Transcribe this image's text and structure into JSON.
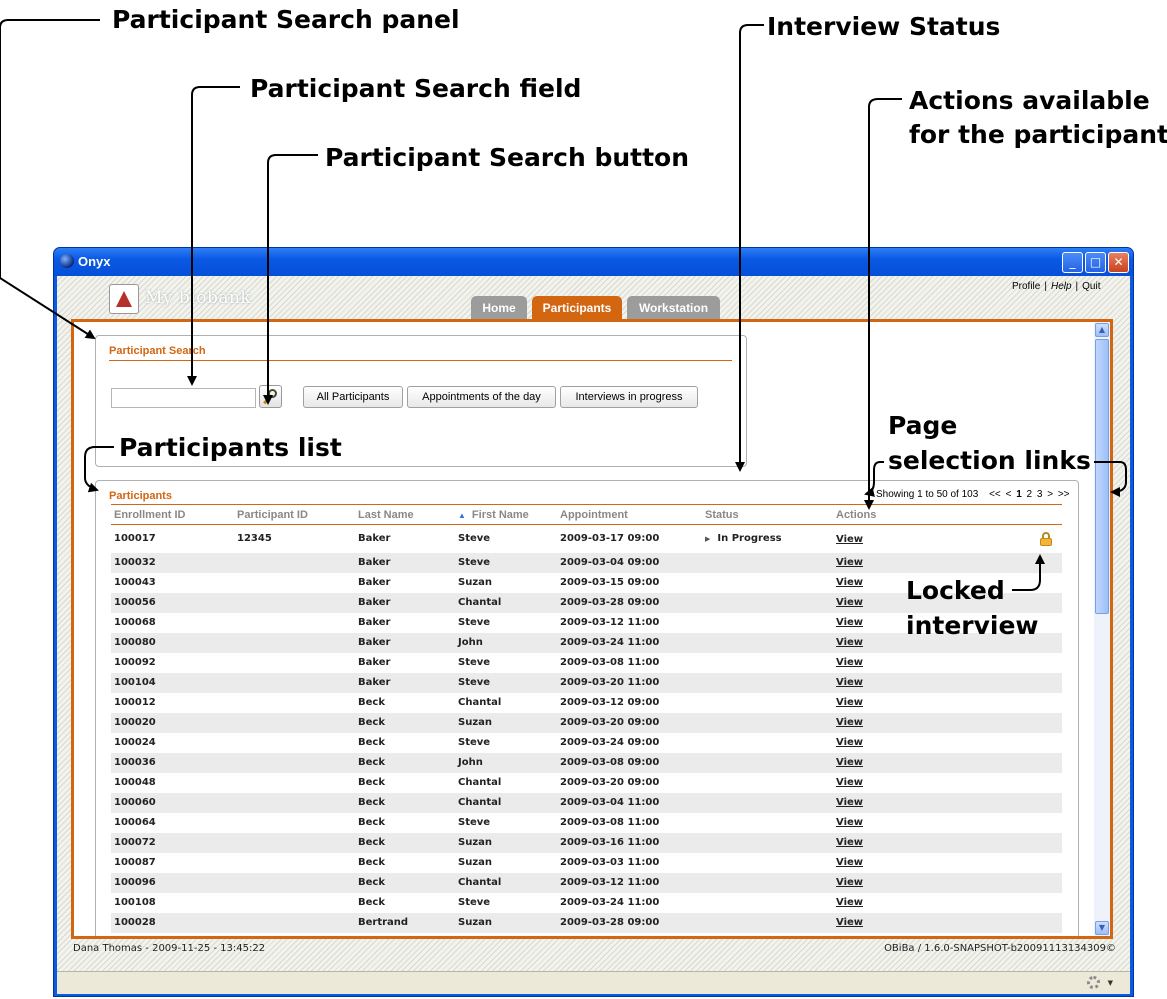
{
  "annotations": {
    "search_panel": "Participant Search panel",
    "search_field": "Participant Search field",
    "search_button": "Participant Search button",
    "interview_status": "Interview Status",
    "actions_line1": "Actions available",
    "actions_line2": "for the participant",
    "participants_list": "Participants list",
    "page_sel_line1": "Page",
    "page_sel_line2": "selection links",
    "locked_line1": "Locked",
    "locked_line2": "interview"
  },
  "window": {
    "title": "Onyx",
    "minimize": "_",
    "maximize": "□",
    "close": "✕"
  },
  "header": {
    "brand": "My biobank",
    "links": {
      "profile": "Profile",
      "sep": "|",
      "help": "Help",
      "quit": "Quit"
    },
    "tabs": {
      "home": "Home",
      "participants": "Participants",
      "workstation": "Workstation"
    }
  },
  "search": {
    "title": "Participant Search",
    "input_value": "",
    "input_placeholder": "",
    "buttons": {
      "all": "All Participants",
      "appointments": "Appointments of the day",
      "in_progress": "Interviews in progress"
    }
  },
  "participants": {
    "title": "Participants",
    "pager": {
      "showing": "Showing 1 to 50 of 103",
      "first": "<<",
      "prev": "<",
      "pages": [
        "1",
        "2",
        "3"
      ],
      "next": ">",
      "last": ">>"
    },
    "columns": [
      "Enrollment ID",
      "Participant ID",
      "Last Name",
      "First Name",
      "Appointment",
      "Status",
      "Actions"
    ],
    "sorted_column": "Last Name",
    "rows": [
      {
        "enrollment_id": "100017",
        "participant_id": "12345",
        "last_name": "Baker",
        "first_name": "Steve",
        "appointment": "2009-03-17 09:00",
        "status": "In Progress",
        "action": "View",
        "locked": true
      },
      {
        "enrollment_id": "100032",
        "participant_id": "",
        "last_name": "Baker",
        "first_name": "Steve",
        "appointment": "2009-03-04 09:00",
        "status": "",
        "action": "View"
      },
      {
        "enrollment_id": "100043",
        "participant_id": "",
        "last_name": "Baker",
        "first_name": "Suzan",
        "appointment": "2009-03-15 09:00",
        "status": "",
        "action": "View"
      },
      {
        "enrollment_id": "100056",
        "participant_id": "",
        "last_name": "Baker",
        "first_name": "Chantal",
        "appointment": "2009-03-28 09:00",
        "status": "",
        "action": "View"
      },
      {
        "enrollment_id": "100068",
        "participant_id": "",
        "last_name": "Baker",
        "first_name": "Steve",
        "appointment": "2009-03-12 11:00",
        "status": "",
        "action": "View"
      },
      {
        "enrollment_id": "100080",
        "participant_id": "",
        "last_name": "Baker",
        "first_name": "John",
        "appointment": "2009-03-24 11:00",
        "status": "",
        "action": "View"
      },
      {
        "enrollment_id": "100092",
        "participant_id": "",
        "last_name": "Baker",
        "first_name": "Steve",
        "appointment": "2009-03-08 11:00",
        "status": "",
        "action": "View"
      },
      {
        "enrollment_id": "100104",
        "participant_id": "",
        "last_name": "Baker",
        "first_name": "Steve",
        "appointment": "2009-03-20 11:00",
        "status": "",
        "action": "View"
      },
      {
        "enrollment_id": "100012",
        "participant_id": "",
        "last_name": "Beck",
        "first_name": "Chantal",
        "appointment": "2009-03-12 09:00",
        "status": "",
        "action": "View"
      },
      {
        "enrollment_id": "100020",
        "participant_id": "",
        "last_name": "Beck",
        "first_name": "Suzan",
        "appointment": "2009-03-20 09:00",
        "status": "",
        "action": "View"
      },
      {
        "enrollment_id": "100024",
        "participant_id": "",
        "last_name": "Beck",
        "first_name": "Steve",
        "appointment": "2009-03-24 09:00",
        "status": "",
        "action": "View"
      },
      {
        "enrollment_id": "100036",
        "participant_id": "",
        "last_name": "Beck",
        "first_name": "John",
        "appointment": "2009-03-08 09:00",
        "status": "",
        "action": "View"
      },
      {
        "enrollment_id": "100048",
        "participant_id": "",
        "last_name": "Beck",
        "first_name": "Chantal",
        "appointment": "2009-03-20 09:00",
        "status": "",
        "action": "View"
      },
      {
        "enrollment_id": "100060",
        "participant_id": "",
        "last_name": "Beck",
        "first_name": "Chantal",
        "appointment": "2009-03-04 11:00",
        "status": "",
        "action": "View"
      },
      {
        "enrollment_id": "100064",
        "participant_id": "",
        "last_name": "Beck",
        "first_name": "Steve",
        "appointment": "2009-03-08 11:00",
        "status": "",
        "action": "View"
      },
      {
        "enrollment_id": "100072",
        "participant_id": "",
        "last_name": "Beck",
        "first_name": "Suzan",
        "appointment": "2009-03-16 11:00",
        "status": "",
        "action": "View"
      },
      {
        "enrollment_id": "100087",
        "participant_id": "",
        "last_name": "Beck",
        "first_name": "Suzan",
        "appointment": "2009-03-03 11:00",
        "status": "",
        "action": "View"
      },
      {
        "enrollment_id": "100096",
        "participant_id": "",
        "last_name": "Beck",
        "first_name": "Chantal",
        "appointment": "2009-03-12 11:00",
        "status": "",
        "action": "View"
      },
      {
        "enrollment_id": "100108",
        "participant_id": "",
        "last_name": "Beck",
        "first_name": "Steve",
        "appointment": "2009-03-24 11:00",
        "status": "",
        "action": "View"
      },
      {
        "enrollment_id": "100028",
        "participant_id": "",
        "last_name": "Bertrand",
        "first_name": "Suzan",
        "appointment": "2009-03-28 09:00",
        "status": "",
        "action": "View"
      }
    ]
  },
  "status_bar": {
    "user_time": "Dana Thomas - 2009-11-25 - 13:45:22",
    "version": "OBiBa / 1.6.0-SNAPSHOT-b20091113134309©"
  },
  "colors": {
    "accent": "#d36611",
    "titlebar": "#0b5be0",
    "tab_inactive": "#9c9c9c",
    "row_alt": "#ebebeb"
  },
  "icons": {
    "app": "globe-icon",
    "logo": "flask-icon",
    "search": "magnifier-icon",
    "sort": "sort-ascending-icon",
    "status": "triangle-right-icon",
    "lock": "lock-icon",
    "settings": "gear-icon"
  }
}
